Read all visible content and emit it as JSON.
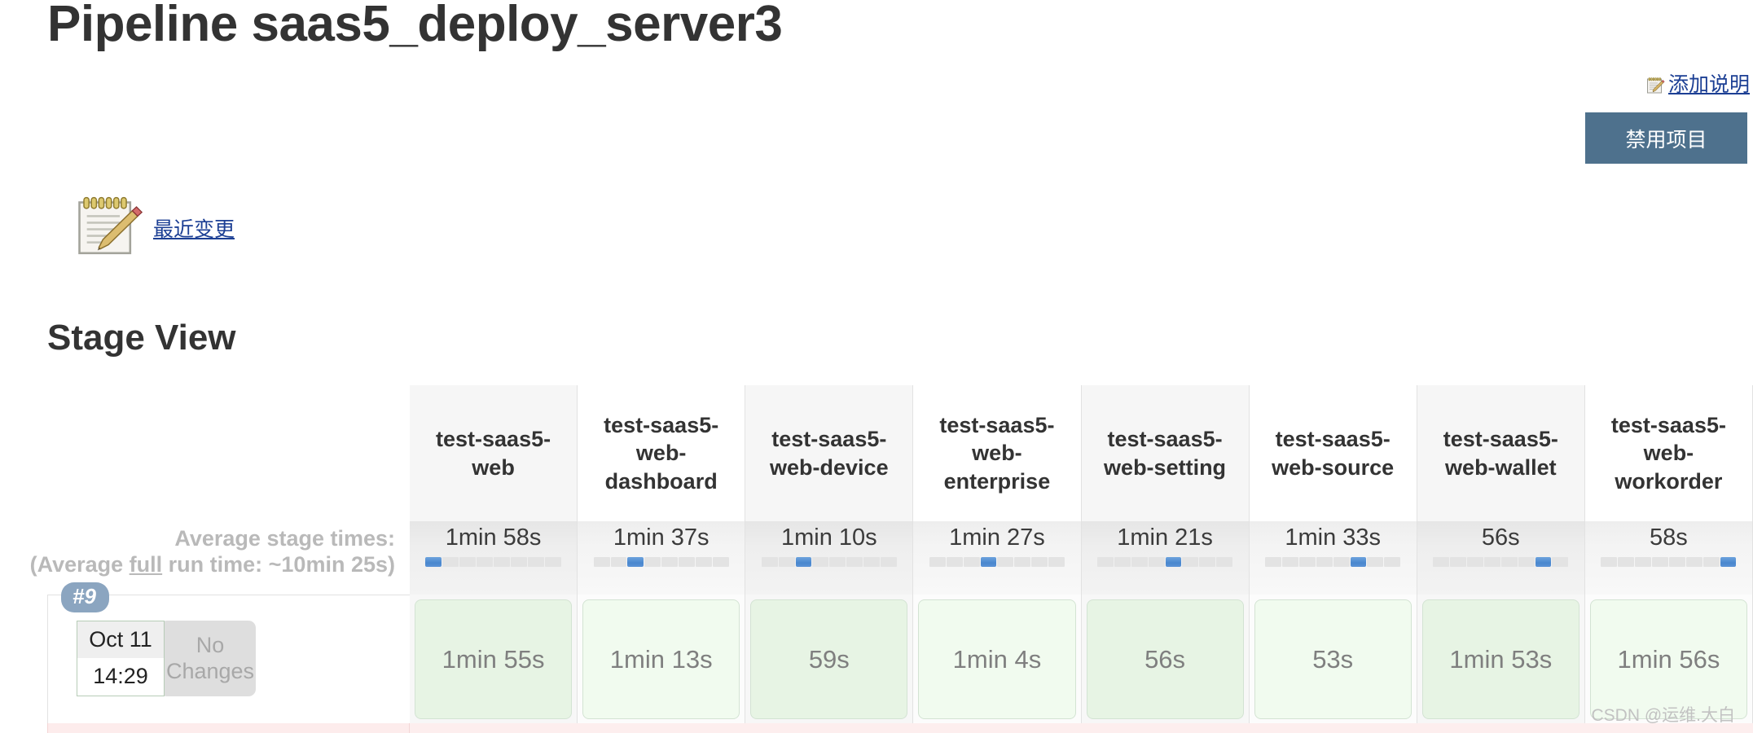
{
  "header": {
    "title": "Pipeline saas5_deploy_server3",
    "add_description_label": "添加说明",
    "add_description_icon": "notepad-pencil-icon",
    "disable_project_label": "禁用项目",
    "disable_project_color": "#4e718d"
  },
  "recent_changes": {
    "label": "最近变更",
    "icon": "notepad-pencil-icon"
  },
  "stage_view": {
    "heading": "Stage View",
    "average_label_line1": "Average stage times:",
    "average_label_line2_pre": "(Average ",
    "average_label_line2_em": "full",
    "average_label_line2_post": " run time: ~10min 25s)",
    "stages": [
      {
        "name": "test-saas5-web",
        "average": "1min 58s",
        "segments": 8,
        "active_segment": 1
      },
      {
        "name": "test-saas5-web-dashboard",
        "average": "1min 37s",
        "segments": 8,
        "active_segment": 3
      },
      {
        "name": "test-saas5-web-device",
        "average": "1min 10s",
        "segments": 8,
        "active_segment": 3
      },
      {
        "name": "test-saas5-web-enterprise",
        "average": "1min 27s",
        "segments": 8,
        "active_segment": 4
      },
      {
        "name": "test-saas5-web-setting",
        "average": "1min 21s",
        "segments": 8,
        "active_segment": 5
      },
      {
        "name": "test-saas5-web-source",
        "average": "1min 33s",
        "segments": 8,
        "active_segment": 6
      },
      {
        "name": "test-saas5-web-wallet",
        "average": "56s",
        "segments": 8,
        "active_segment": 7
      },
      {
        "name": "test-saas5-web-workorder",
        "average": "58s",
        "segments": 8,
        "active_segment": 8
      }
    ],
    "builds": [
      {
        "number": "#9",
        "date": "Oct 11",
        "time": "14:29",
        "changes": "No Changes",
        "status_color": "#e7f4e4",
        "durations": [
          "1min 55s",
          "1min 13s",
          "59s",
          "1min 4s",
          "56s",
          "53s",
          "1min 53s",
          "1min 56s"
        ]
      }
    ]
  },
  "watermark": "CSDN @运维.大白"
}
